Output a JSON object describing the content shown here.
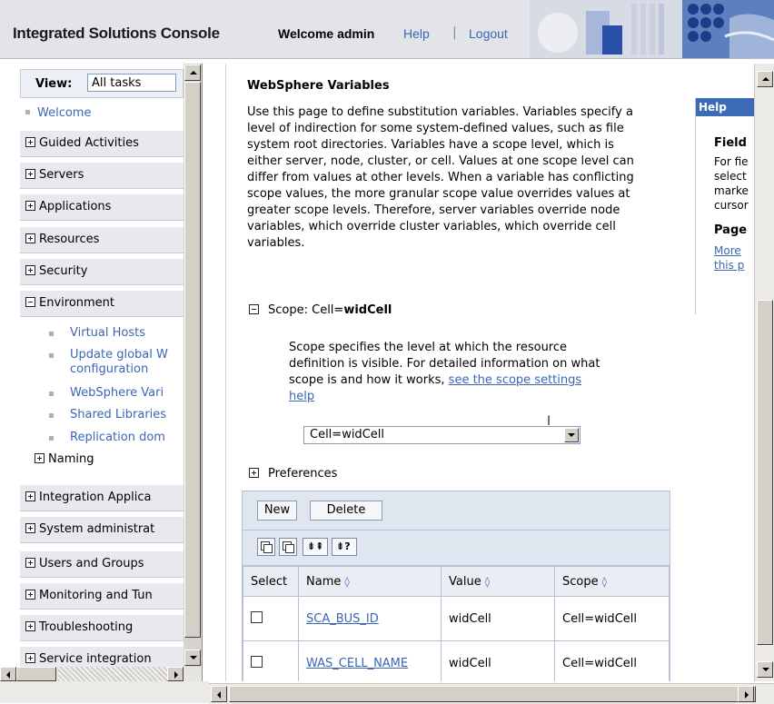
{
  "banner": {
    "title": "Integrated Solutions Console",
    "welcome": "Welcome admin",
    "help": "Help",
    "separator": "|",
    "logout": "Logout"
  },
  "nav": {
    "view_label": "View:",
    "view_value": "All tasks",
    "welcome": "Welcome",
    "items": [
      {
        "label": "Guided Activities",
        "expanded": false
      },
      {
        "label": "Servers",
        "expanded": false
      },
      {
        "label": "Applications",
        "expanded": false
      },
      {
        "label": "Resources",
        "expanded": false
      },
      {
        "label": "Security",
        "expanded": false
      },
      {
        "label": "Environment",
        "expanded": true
      }
    ],
    "environment_children": [
      "Virtual Hosts",
      "Update global W",
      "configuration",
      "WebSphere Vari",
      "Shared Libraries",
      "Replication dom"
    ],
    "naming": "Naming",
    "items_after": [
      {
        "label": "Integration Applica"
      },
      {
        "label": "System administrat"
      },
      {
        "label": "Users and Groups"
      },
      {
        "label": "Monitoring and Tun"
      },
      {
        "label": "Troubleshooting"
      },
      {
        "label": "Service integration"
      }
    ]
  },
  "main": {
    "title": "WebSphere Variables",
    "description": "Use this page to define substitution variables. Variables specify a level of indirection for some system-defined values, such as file system root directories. Variables have a scope level, which is either server, node, cluster, or cell. Values at one scope level can differ from values at other levels. When a variable has conflicting scope values, the more granular scope value overrides values at greater scope levels. Therefore, server variables override node variables, which override cluster variables, which override cell variables.",
    "scope_label": "Scope: Cell=",
    "scope_bold": "widCell",
    "scope_desc": "Scope specifies the level at which the resource definition is visible. For detailed information on what scope is and how it works,",
    "scope_link": "see the scope settings help",
    "scope_select": "Cell=widCell",
    "preferences": "Preferences",
    "buttons": {
      "new": "New",
      "delete": "Delete"
    },
    "toolbar_icons": [
      "select-all-icon",
      "deselect-all-icon",
      "show-filter-icon",
      "hide-filter-icon"
    ],
    "table": {
      "headers": [
        "Select",
        "Name",
        "Value",
        "Scope"
      ],
      "rows": [
        {
          "name": "SCA_BUS_ID",
          "value": "widCell",
          "scope": "Cell=widCell"
        },
        {
          "name": "WAS_CELL_NAME",
          "value": "widCell",
          "scope": "Cell=widCell"
        }
      ]
    }
  },
  "help": {
    "header": "Help",
    "field_title": "Field",
    "field_text": "For fie\nselect\nmarke\ncursor",
    "page_title": "Page",
    "page_link": "More\nthis p"
  },
  "colors": {
    "link": "#3a66b4",
    "help_header": "#3d6bb6",
    "banner": "#e2e4e8"
  }
}
